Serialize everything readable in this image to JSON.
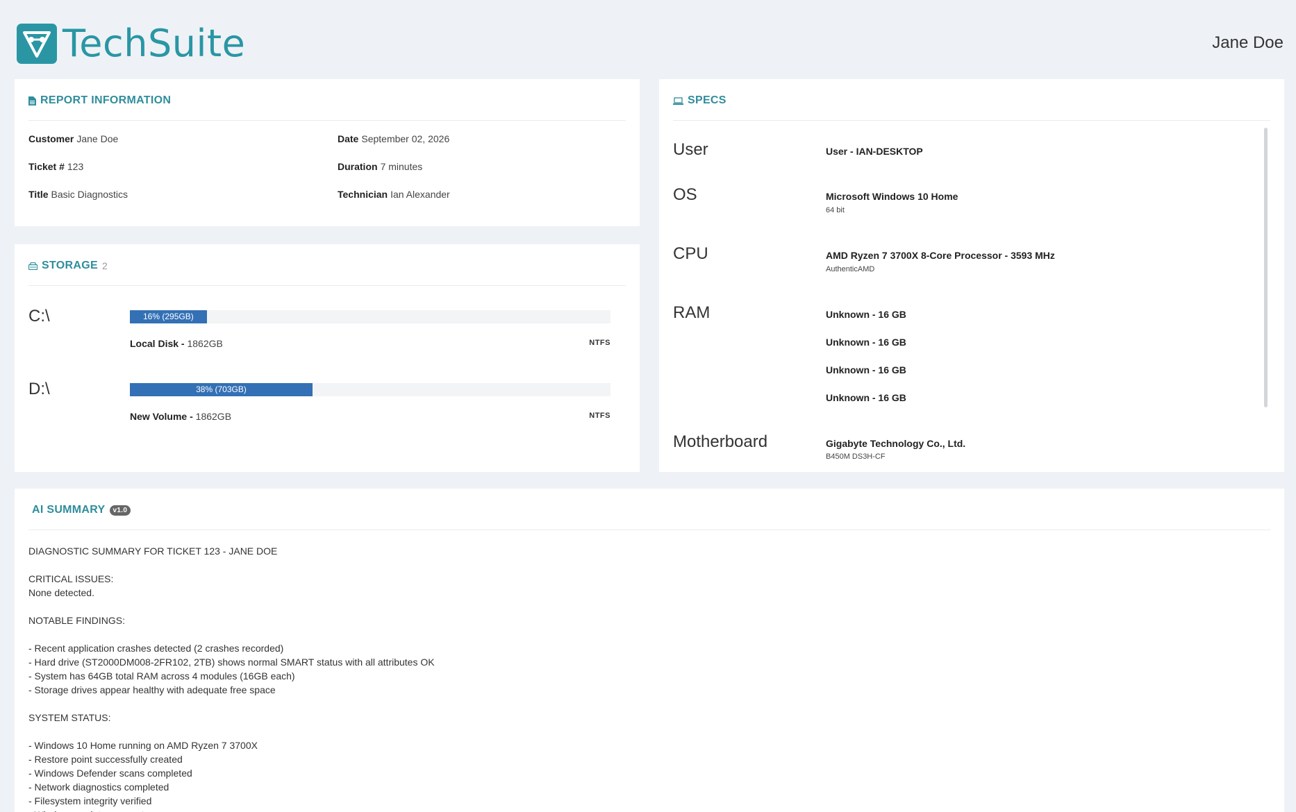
{
  "header": {
    "brand": "TechSuite",
    "user": "Jane Doe"
  },
  "report": {
    "title": "REPORT INFORMATION",
    "customer_label": "Customer",
    "customer": "Jane Doe",
    "ticket_label": "Ticket #",
    "ticket": "123",
    "title_label": "Title",
    "title_value": "Basic Diagnostics",
    "date_label": "Date",
    "date": "September 02, 2026",
    "duration_label": "Duration",
    "duration": "7 minutes",
    "technician_label": "Technician",
    "technician": "Ian Alexander"
  },
  "storage": {
    "title": "STORAGE",
    "count": "2",
    "drives": [
      {
        "letter": "C:\\",
        "used_percent": 16,
        "bar_label": "16% (295GB)",
        "name": "Local Disk -",
        "size": "1862GB",
        "fs": "NTFS"
      },
      {
        "letter": "D:\\",
        "used_percent": 38,
        "bar_label": "38% (703GB)",
        "name": "New Volume -",
        "size": "1862GB",
        "fs": "NTFS"
      }
    ]
  },
  "specs": {
    "title": "SPECS",
    "user_key": "User",
    "user_val": "User - IAN-DESKTOP",
    "os_key": "OS",
    "os_val": "Microsoft Windows 10 Home",
    "os_sub": "64 bit",
    "cpu_key": "CPU",
    "cpu_val": "AMD Ryzen 7 3700X 8-Core Processor - 3593 MHz",
    "cpu_sub": "AuthenticAMD",
    "ram_key": "RAM",
    "ram": [
      "Unknown - 16 GB",
      "Unknown - 16 GB",
      "Unknown - 16 GB",
      "Unknown - 16 GB"
    ],
    "mb_key": "Motherboard",
    "mb_val": "Gigabyte Technology Co., Ltd.",
    "mb_sub": "B450M DS3H-CF"
  },
  "summary": {
    "title": "AI SUMMARY",
    "version": "v1.0",
    "text": "DIAGNOSTIC SUMMARY FOR TICKET 123 - JANE DOE\n\nCRITICAL ISSUES:\nNone detected.\n\nNOTABLE FINDINGS:\n\n- Recent application crashes detected (2 crashes recorded)\n- Hard drive (ST2000DM008-2FR102, 2TB) shows normal SMART status with all attributes OK\n- System has 64GB total RAM across 4 modules (16GB each)\n- Storage drives appear healthy with adequate free space\n\nSYSTEM STATUS:\n\n- Windows 10 Home running on AMD Ryzen 7 3700X\n- Restore point successfully created\n- Windows Defender scans completed\n- Network diagnostics completed\n- Filesystem integrity verified\n- Windows updates current"
  }
}
